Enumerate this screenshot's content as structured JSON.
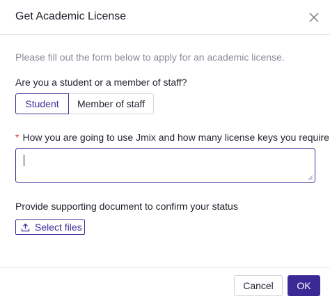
{
  "dialog": {
    "title": "Get Academic License",
    "close_icon": "close-icon"
  },
  "form": {
    "intro": "Please fill out the form below to apply for an academic license.",
    "role_question": "Are you a student or a member of staff?",
    "role_options": [
      "Student",
      "Member of staff"
    ],
    "role_selected": "Student",
    "usage_required_mark": "*",
    "usage_label": "How you are going to use Jmix and how many license keys you require",
    "usage_value": "",
    "document_label": "Provide supporting document to confirm your status",
    "select_files_label": "Select files",
    "upload_icon": "upload-icon"
  },
  "footer": {
    "cancel_label": "Cancel",
    "ok_label": "OK"
  },
  "colors": {
    "accent": "#3b2a96",
    "required": "#e0463c",
    "muted_text": "#8b8b98"
  }
}
